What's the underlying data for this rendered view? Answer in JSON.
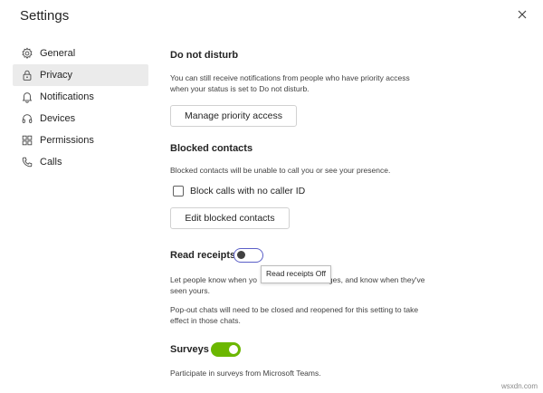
{
  "window": {
    "title": "Settings"
  },
  "sidebar": {
    "items": [
      {
        "label": "General",
        "icon": "gear-icon",
        "active": false
      },
      {
        "label": "Privacy",
        "icon": "lock-icon",
        "active": true
      },
      {
        "label": "Notifications",
        "icon": "bell-icon",
        "active": false
      },
      {
        "label": "Devices",
        "icon": "headset-icon",
        "active": false
      },
      {
        "label": "Permissions",
        "icon": "shield-grid-icon",
        "active": false
      },
      {
        "label": "Calls",
        "icon": "phone-icon",
        "active": false
      }
    ]
  },
  "dnd": {
    "heading": "Do not disturb",
    "description_line1": "You can still receive notifications from people who have priority access",
    "description_line2": "when your status is set to Do not disturb.",
    "button": "Manage priority access"
  },
  "blocked": {
    "heading": "Blocked contacts",
    "description": "Blocked contacts will be unable to call you or see your presence.",
    "checkbox_label": "Block calls with no caller ID",
    "checkbox_checked": false,
    "button": "Edit blocked contacts"
  },
  "read_receipts": {
    "heading": "Read receipts",
    "enabled": false,
    "tooltip": "Read receipts Off",
    "description_line1a": "Let people know when yo",
    "description_line1b": "sages, and know when they've",
    "description_line2": "seen yours.",
    "note_line1": "Pop-out chats will need to be closed and reopened for this setting to take",
    "note_line2": "effect in those chats."
  },
  "surveys": {
    "heading": "Surveys",
    "enabled": true,
    "description": "Participate in surveys from Microsoft Teams."
  },
  "colors": {
    "toggle_off_border": "#5b5fc7",
    "toggle_on": "#6bb700",
    "active_nav_bg": "#ebebeb"
  },
  "watermark": "wsxdn.com"
}
